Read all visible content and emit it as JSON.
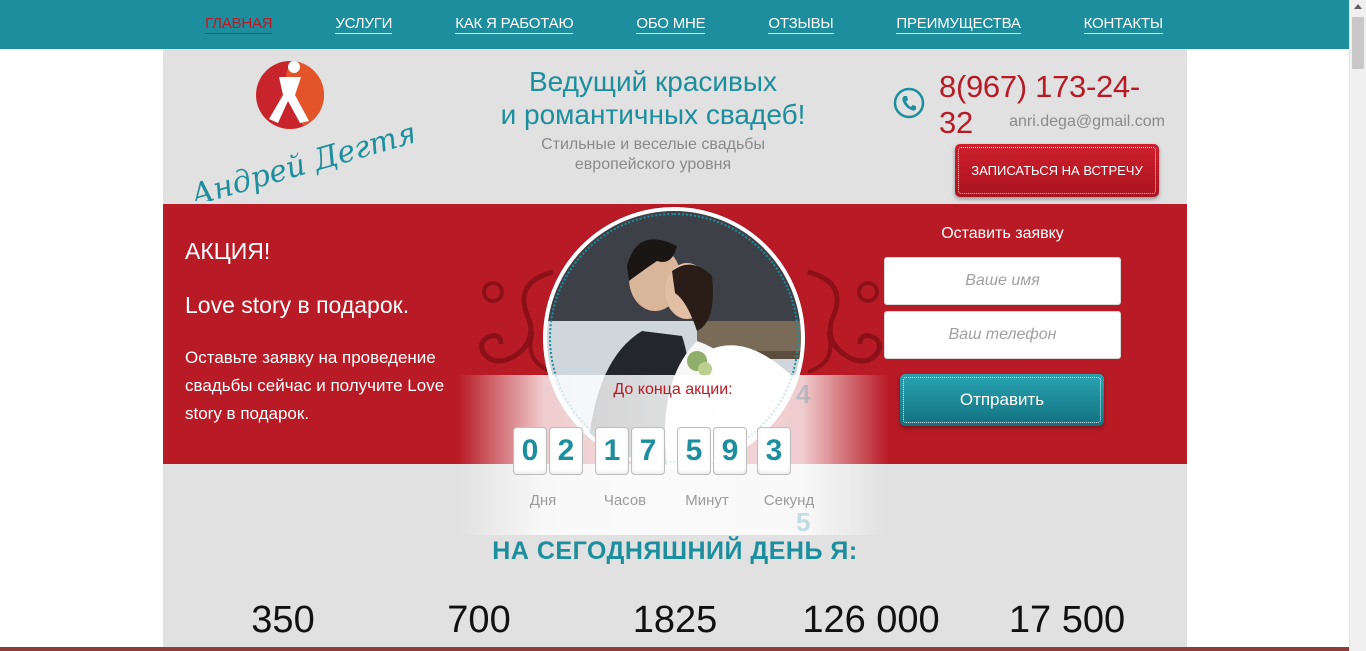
{
  "nav": {
    "items": [
      {
        "label": "ГЛАВНАЯ",
        "active": true
      },
      {
        "label": "УСЛУГИ",
        "active": false
      },
      {
        "label": "КАК Я РАБОТАЮ",
        "active": false
      },
      {
        "label": "ОБО МНЕ",
        "active": false
      },
      {
        "label": "ОТЗЫВЫ",
        "active": false
      },
      {
        "label": "ПРЕИМУЩЕСТВА",
        "active": false
      },
      {
        "label": "КОНТАКТЫ",
        "active": false
      }
    ]
  },
  "header": {
    "logo_text": "Андрей Дегтярев",
    "tagline_line1": "Ведущий красивых",
    "tagline_line2": "и романтичных свадеб!",
    "subtitle_line1": "Стильные и веселые свадьбы",
    "subtitle_line2": "европейского уровня",
    "phone": "8(967) 173-24-32",
    "email": "anri.dega@gmail.com",
    "meet_button": "ЗАПИСАТЬСЯ НА ВСТРЕЧУ"
  },
  "promo": {
    "label": "АКЦИЯ!",
    "title": "Love story в подарок.",
    "description": "Оставьте заявку на проведение свадьбы сейчас и получите Love story в подарок."
  },
  "form": {
    "title": "Оставить заявку",
    "name_placeholder": "Ваше имя",
    "phone_placeholder": "Ваш телефон",
    "submit_label": "Отправить"
  },
  "countdown": {
    "title": "До конца акции:",
    "digits": [
      "0",
      "2",
      "1",
      "7",
      "5",
      "9",
      "3"
    ],
    "units": [
      "Дня",
      "Часов",
      "Минут",
      "Секунд"
    ],
    "ghost_top": "4",
    "ghost_bottom": "5"
  },
  "stats": {
    "title": "НА СЕГОДНЯШНИЙ ДЕНЬ Я:",
    "values": [
      "350",
      "700",
      "1825",
      "126 000",
      "17 500"
    ]
  },
  "colors": {
    "teal": "#1c8e9e",
    "red": "#b81b25",
    "gray_bg": "#e1e1e1"
  },
  "icons": {
    "phone": "phone-icon",
    "logo": "dancer-logo-icon"
  }
}
